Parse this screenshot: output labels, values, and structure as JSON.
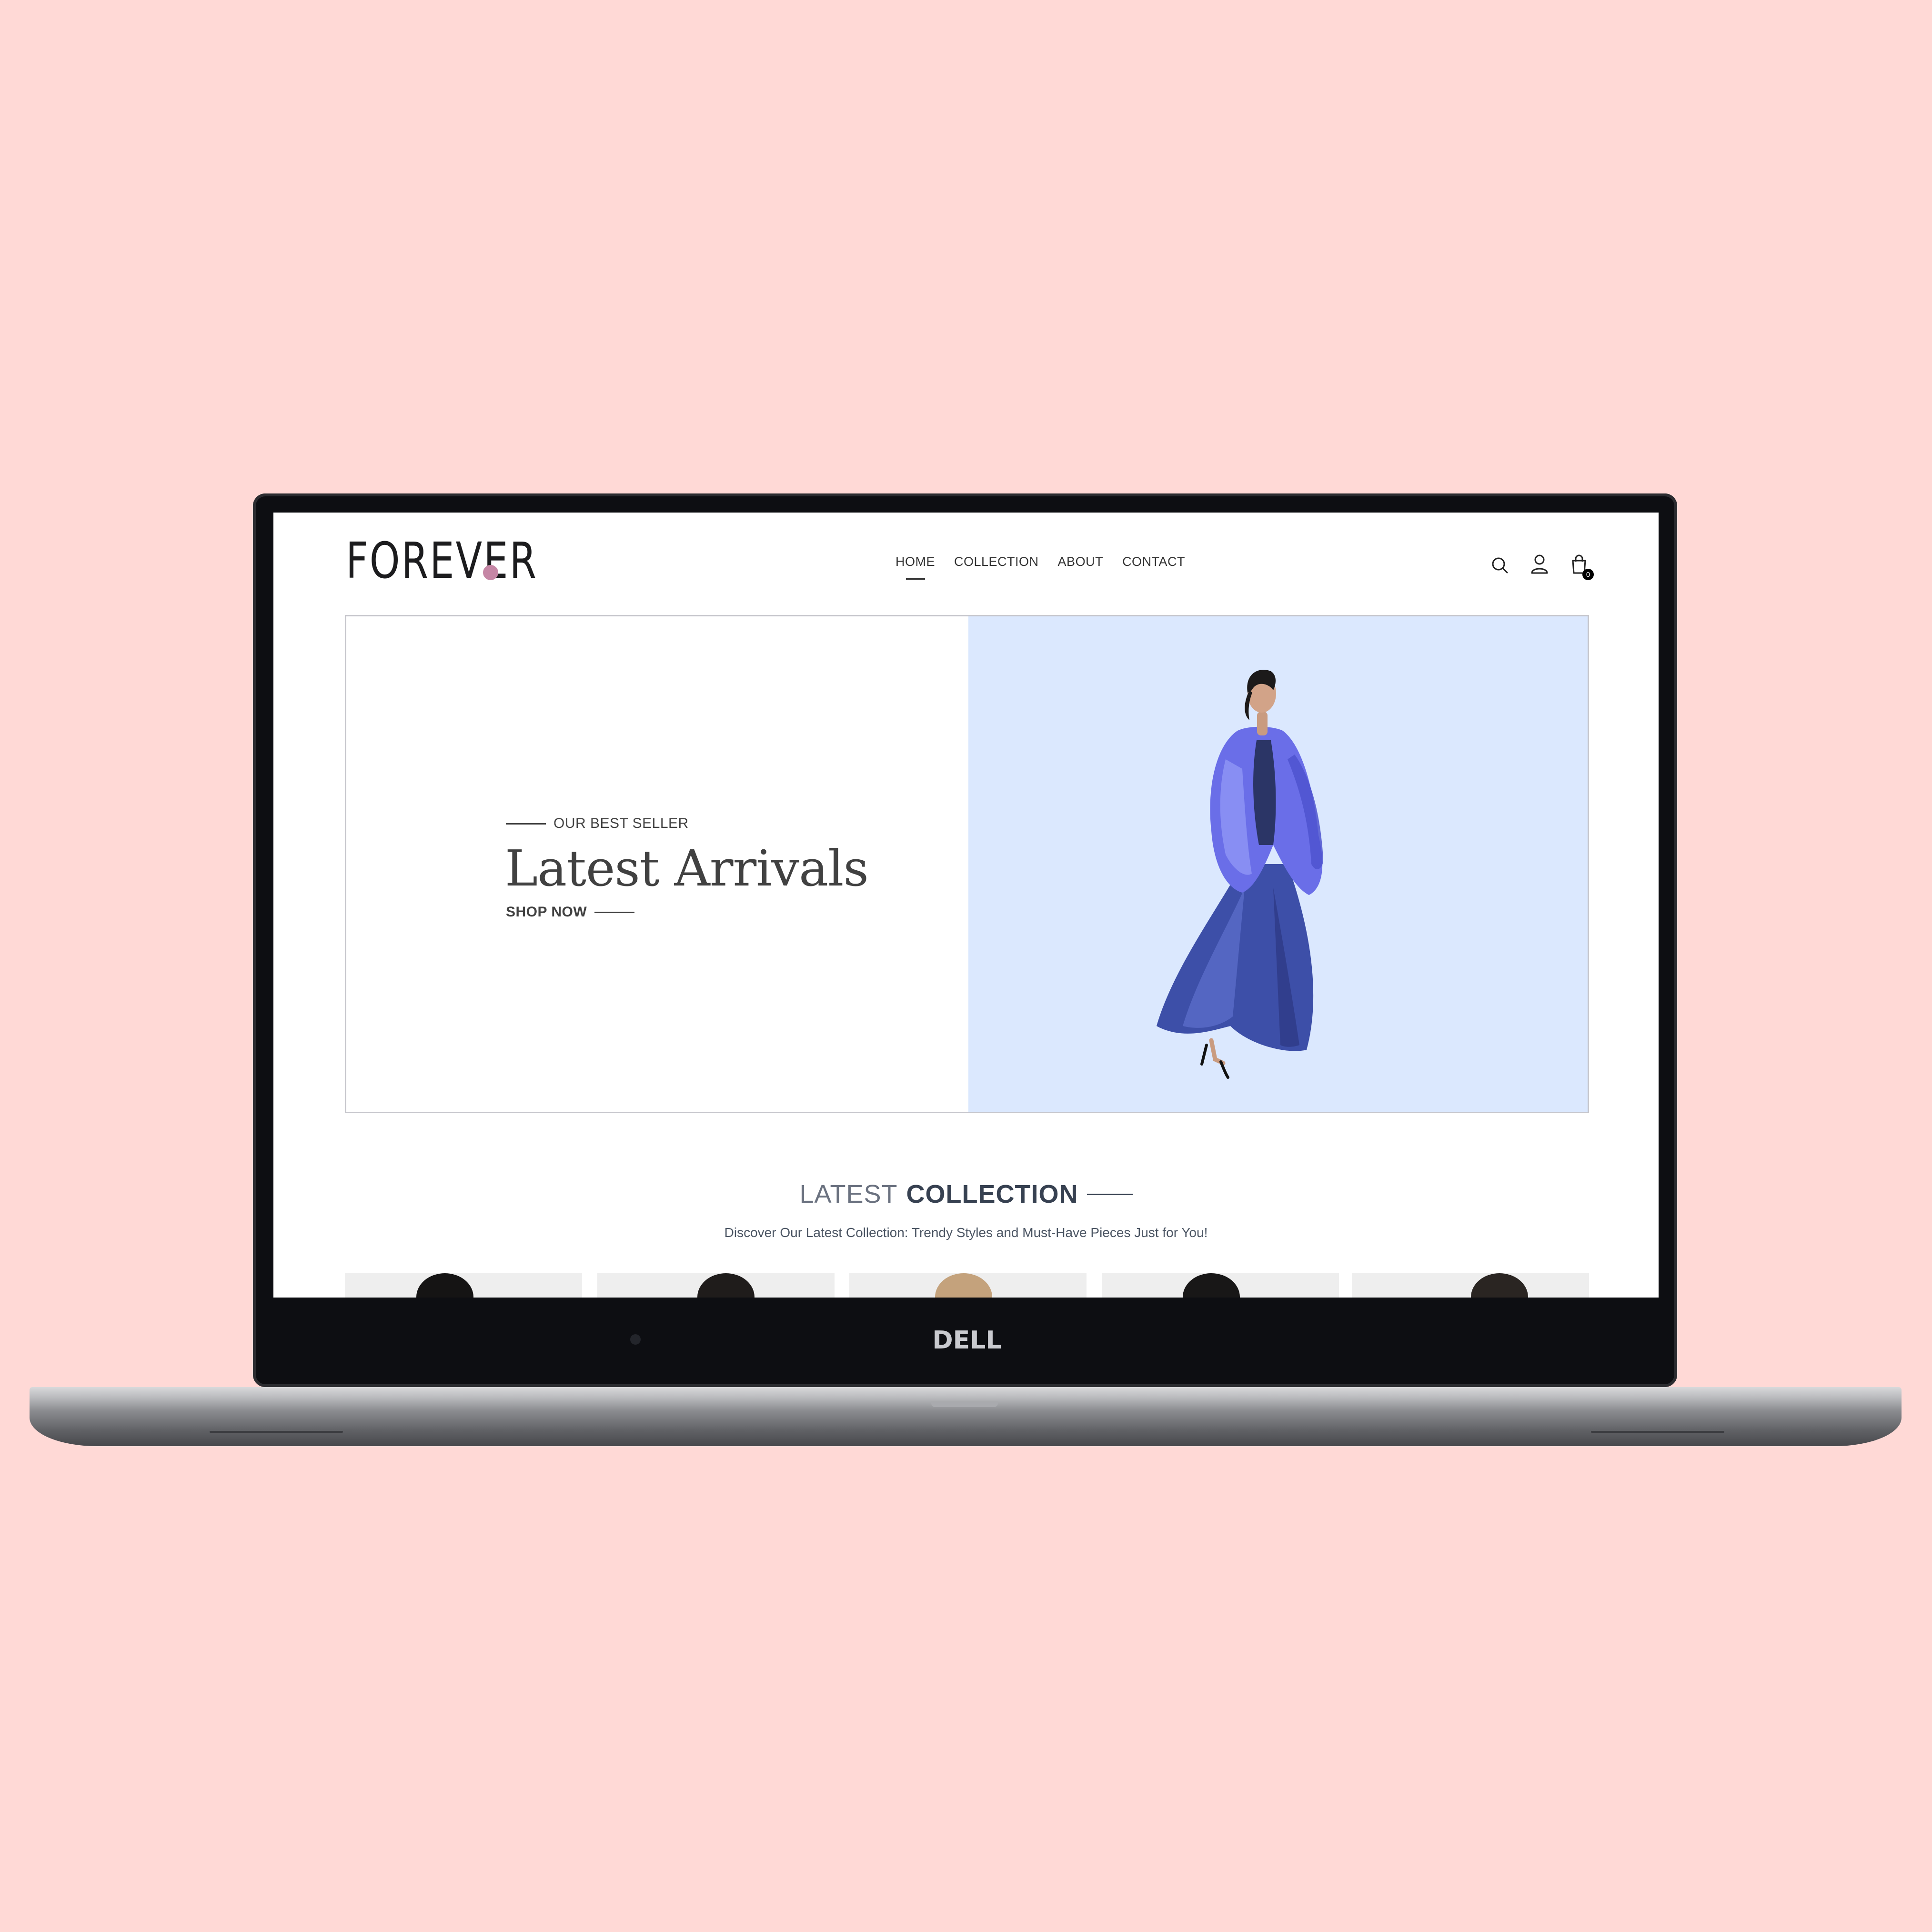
{
  "site": {
    "logo": "FOREVER",
    "nav": [
      "HOME",
      "COLLECTION",
      "ABOUT",
      "CONTACT"
    ],
    "active_nav": "HOME",
    "cart_count": "0",
    "icons": [
      "search-icon",
      "profile-icon",
      "cart-icon"
    ]
  },
  "hero": {
    "kicker": "OUR BEST SELLER",
    "title": "Latest Arrivals",
    "cta": "SHOP NOW",
    "image_bg": "#dbe8fe"
  },
  "latest": {
    "title_a": "LATEST",
    "title_b": "COLLECTION",
    "subtitle": "Discover Our Latest Collection: Trendy Styles and Must-Have Pieces Just for You!"
  },
  "device": {
    "brand": "DELL"
  },
  "colors": {
    "page_bg": "#ffd9d6",
    "accent_dot": "#c586a5",
    "text": "#414141"
  }
}
